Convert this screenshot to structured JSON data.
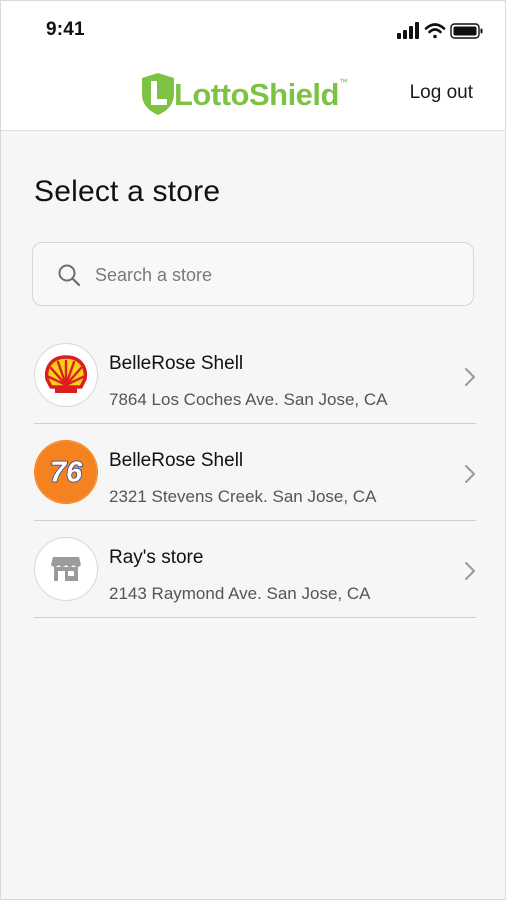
{
  "status_bar": {
    "time": "9:41"
  },
  "header": {
    "logo_text": "LottoShield",
    "logo_trademark": "™",
    "logout_label": "Log out",
    "brand_color": "#7cc243"
  },
  "page": {
    "title": "Select a store",
    "search_placeholder": "Search a store"
  },
  "stores": [
    {
      "name": "BelleRose Shell",
      "address": "7864 Los Coches Ave. San Jose, CA",
      "logo": "shell-logo"
    },
    {
      "name": "BelleRose Shell",
      "address": "2321 Stevens Creek. San Jose, CA",
      "logo": "76-logo",
      "logo_text": "76"
    },
    {
      "name": "Ray's store",
      "address": "2143 Raymond Ave. San Jose, CA",
      "logo": "store-icon"
    }
  ],
  "icons": [
    "signal-icon",
    "wifi-icon",
    "battery-icon",
    "search-icon",
    "chevron-right-icon"
  ]
}
